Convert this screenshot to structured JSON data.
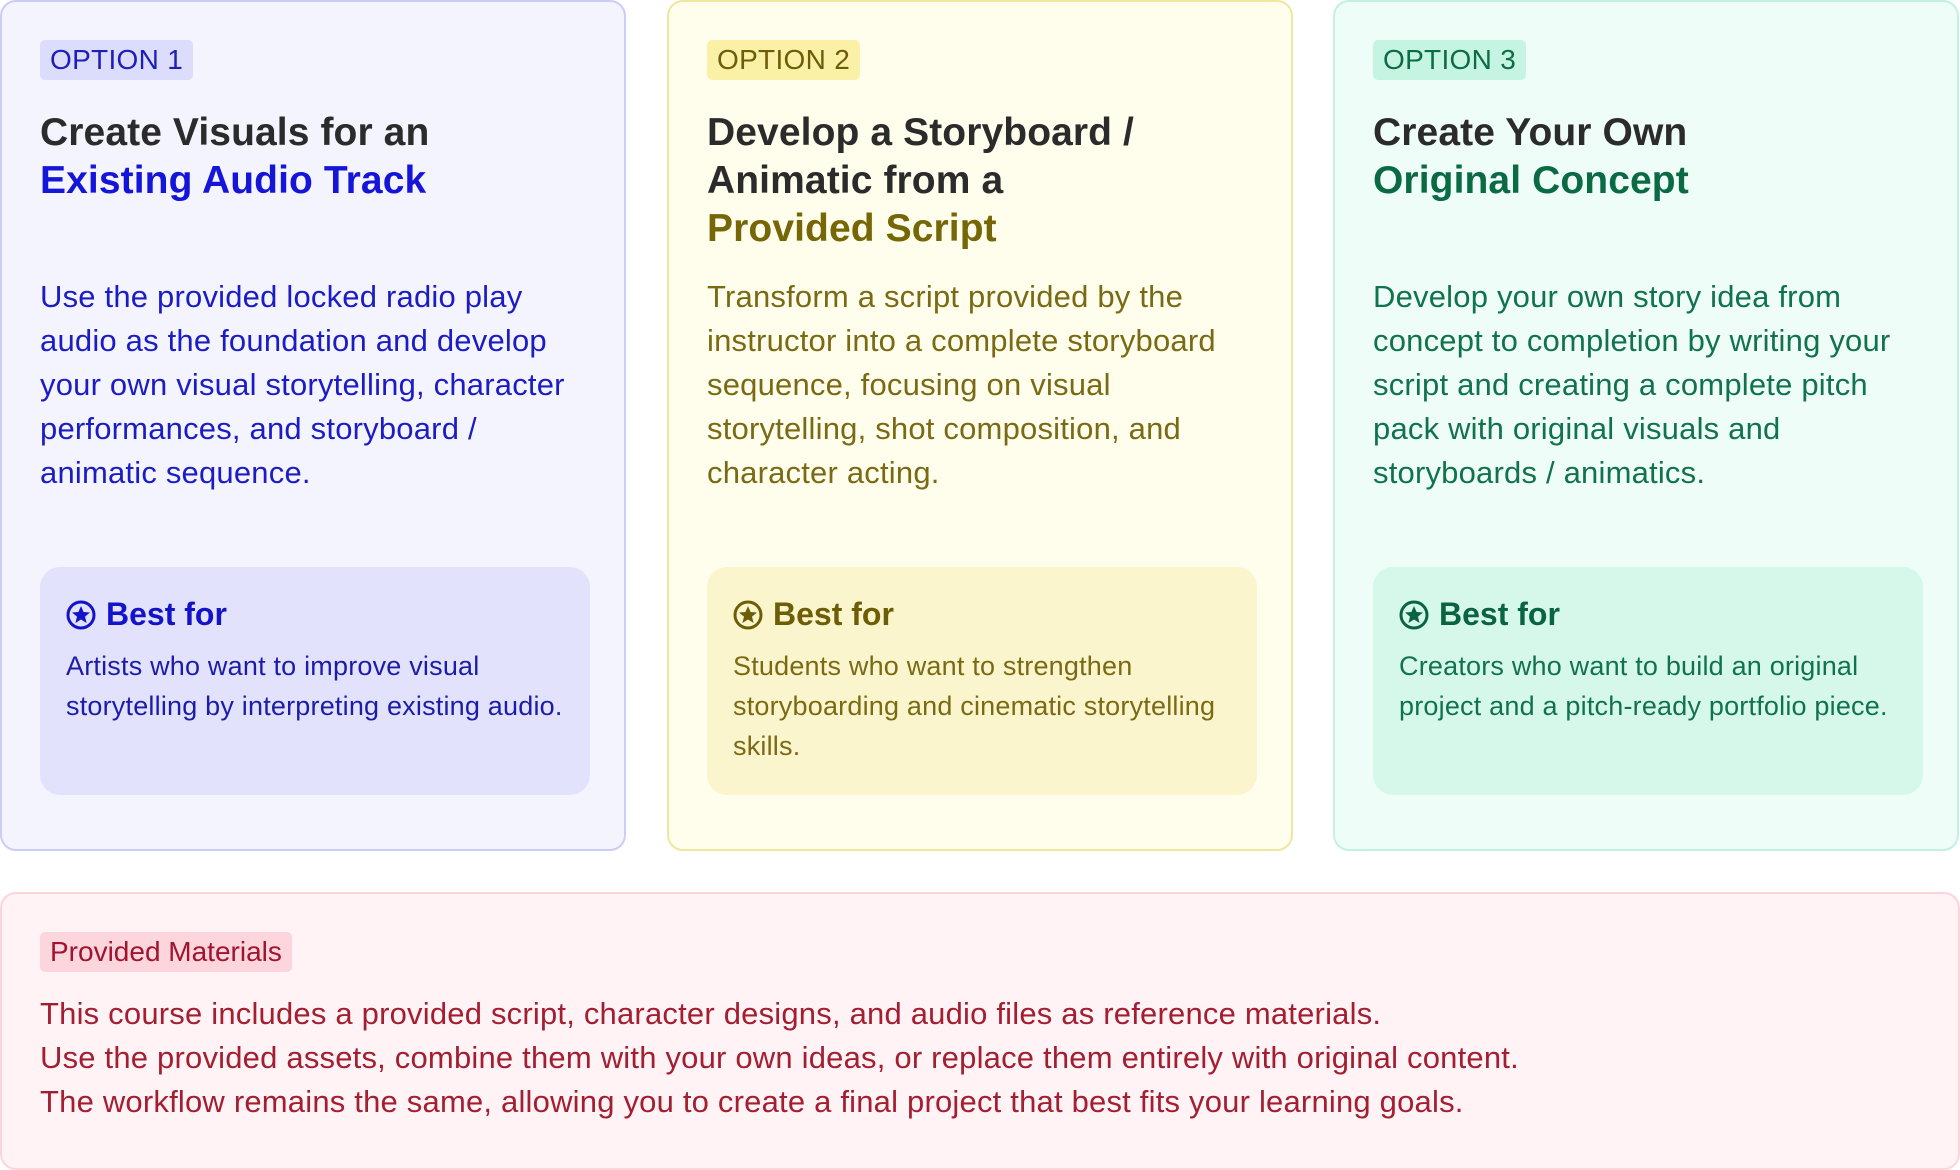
{
  "options": [
    {
      "badge": "OPTION 1",
      "title_dark": [
        "Create Visuals for an"
      ],
      "title_accent": "Existing Audio Track",
      "description": "Use the provided locked radio play audio as the foundation and develop your own visual storytelling, character performances, and storyboard / animatic sequence.",
      "best_for": {
        "icon": "star-circle-icon",
        "heading": "Best for",
        "text": "Artists who want to improve visual storytelling by interpreting existing audio."
      },
      "colors": {
        "accent": "#1515d9",
        "background": "#f4f4ff"
      }
    },
    {
      "badge": "OPTION 2",
      "title_dark": [
        "Develop a Storyboard /",
        "Animatic from a"
      ],
      "title_accent": "Provided Script",
      "description": "Transform a script provided by the instructor into a complete storyboard sequence, focusing on visual storytelling, shot composition, and character acting.",
      "best_for": {
        "icon": "star-circle-icon",
        "heading": "Best for",
        "text": "Students who want to strengthen storyboarding and cinematic storytelling skills."
      },
      "colors": {
        "accent": "#766606",
        "background": "#fffeed"
      }
    },
    {
      "badge": "OPTION 3",
      "title_dark": [
        "Create Your Own"
      ],
      "title_accent": "Original Concept",
      "description": "Develop your own story idea from concept to completion by writing your script and creating a complete pitch pack with original visuals and storyboards / animatics.",
      "best_for": {
        "icon": "star-circle-icon",
        "heading": "Best for",
        "text": "Creators who want to build an original project and a pitch-ready portfolio piece."
      },
      "colors": {
        "accent": "#0a6a44",
        "background": "#eefdf8"
      }
    }
  ],
  "materials": {
    "badge": "Provided Materials",
    "lines": [
      "This course includes a provided script, character designs, and audio files as reference materials.",
      "Use the provided assets, combine them with your own ideas, or replace them entirely with original content.",
      "The workflow remains the same, allowing you to create a final project that best fits your learning goals."
    ],
    "colors": {
      "accent": "#a41e31",
      "background": "#fff3f5"
    }
  }
}
